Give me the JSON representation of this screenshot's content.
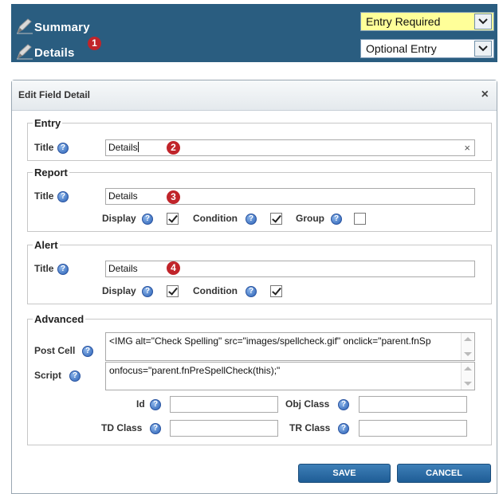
{
  "header": {
    "summary": {
      "label": "Summary",
      "select_value": "Entry Required",
      "select_bg": "#ffff99"
    },
    "details": {
      "label": "Details",
      "marker": "1",
      "select_value": "Optional Entry",
      "select_bg": "#ffffff"
    }
  },
  "dialog": {
    "title": "Edit Field Detail",
    "close_glyph": "×",
    "entry": {
      "legend": "Entry",
      "title_label": "Title",
      "title_value": "Details",
      "clear_glyph": "×",
      "marker": "2"
    },
    "report": {
      "legend": "Report",
      "title_label": "Title",
      "title_value": "Details",
      "marker": "3",
      "display_label": "Display",
      "display_checked": true,
      "condition_label": "Condition",
      "condition_checked": true,
      "group_label": "Group",
      "group_checked": false
    },
    "alert": {
      "legend": "Alert",
      "title_label": "Title",
      "title_value": "Details",
      "marker": "4",
      "display_label": "Display",
      "display_checked": true,
      "condition_label": "Condition",
      "condition_checked": true
    },
    "advanced": {
      "legend": "Advanced",
      "post_cell_label": "Post Cell",
      "post_cell_value": "<IMG alt=\"Check Spelling\" src=\"images/spellcheck.gif\" onclick=\"parent.fnSp",
      "script_label": "Script",
      "script_value": "onfocus=\"parent.fnPreSpellCheck(this);\"",
      "id_label": "Id",
      "id_value": "",
      "obj_class_label": "Obj Class",
      "obj_class_value": "",
      "td_class_label": "TD Class",
      "td_class_value": "",
      "tr_class_label": "TR Class",
      "tr_class_value": ""
    },
    "buttons": {
      "save": "SAVE",
      "cancel": "CANCEL"
    }
  },
  "icons": {
    "help": "help-icon",
    "pen": "pen-icon",
    "close": "close-icon",
    "dropdown": "chevron-down-icon"
  },
  "colors": {
    "header_bg": "#2a5d80",
    "marker_red": "#c0242a",
    "button_blue": "#2a6aa6"
  }
}
